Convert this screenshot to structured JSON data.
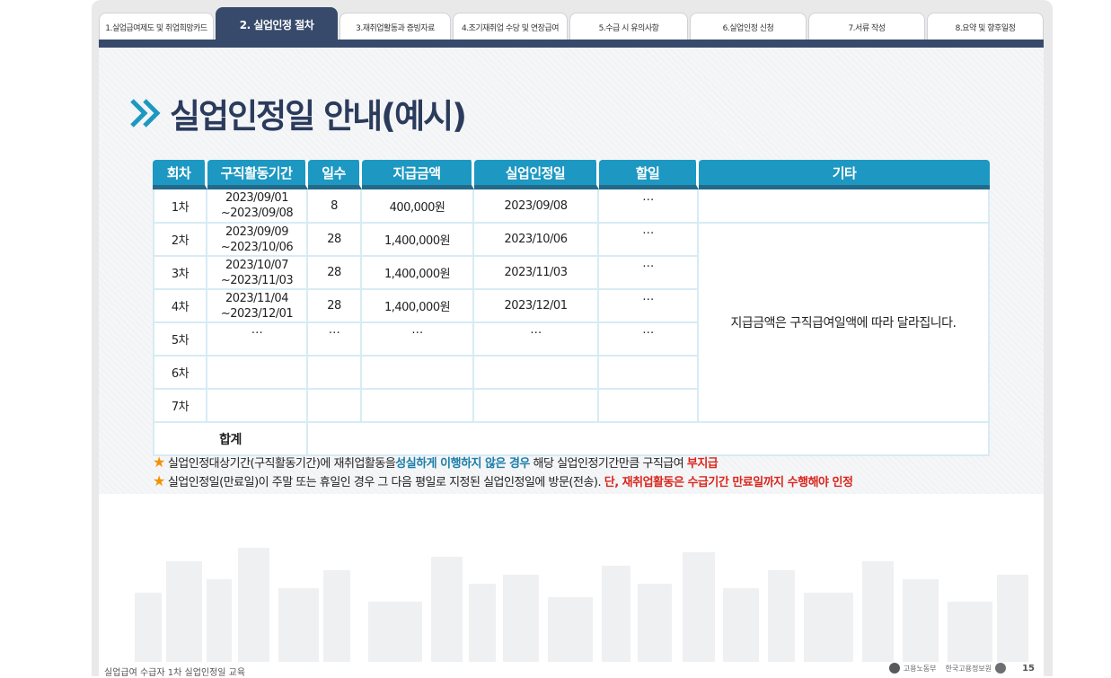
{
  "tabs": [
    {
      "label": "1.실업급여제도 및 취업희망카드",
      "active": false
    },
    {
      "label": "2. 실업인정 절차",
      "active": true
    },
    {
      "label": "3.재취업활동과 증빙자료",
      "active": false
    },
    {
      "label": "4.조기재취업 수당 및 연장급여",
      "active": false
    },
    {
      "label": "5.수급 시 유의사항",
      "active": false
    },
    {
      "label": "6.실업인정 신청",
      "active": false
    },
    {
      "label": "7.서류 작성",
      "active": false
    },
    {
      "label": "8.요약 및 향후일정",
      "active": false
    }
  ],
  "page_title": "실업인정일 안내(예시)",
  "table": {
    "headers": [
      "회차",
      "구직활동기간",
      "일수",
      "지급금액",
      "실업인정일",
      "할일",
      "기타"
    ],
    "rows": [
      {
        "round": "1차",
        "period_start": "2023/09/01",
        "period_end": "~2023/09/08",
        "days": "8",
        "amount": "400,000원",
        "date": "2023/09/08",
        "task": "…"
      },
      {
        "round": "2차",
        "period_start": "2023/09/09",
        "period_end": "~2023/10/06",
        "days": "28",
        "amount": "1,400,000원",
        "date": "2023/10/06",
        "task": "…"
      },
      {
        "round": "3차",
        "period_start": "2023/10/07",
        "period_end": "~2023/11/03",
        "days": "28",
        "amount": "1,400,000원",
        "date": "2023/11/03",
        "task": "…"
      },
      {
        "round": "4차",
        "period_start": "2023/11/04",
        "period_end": "~2023/12/01",
        "days": "28",
        "amount": "1,400,000원",
        "date": "2023/12/01",
        "task": "…"
      },
      {
        "round": "5차",
        "period_start": "…",
        "period_end": "",
        "days": "…",
        "amount": "…",
        "date": "…",
        "task": "…"
      },
      {
        "round": "6차",
        "period_start": "",
        "period_end": "",
        "days": "",
        "amount": "",
        "date": "",
        "task": ""
      },
      {
        "round": "7차",
        "period_start": "",
        "period_end": "",
        "days": "",
        "amount": "",
        "date": "",
        "task": ""
      }
    ],
    "note": "지급금액은 구직급여일액에 따라 달라집니다.",
    "total_label": "합계"
  },
  "notes": [
    {
      "parts": [
        {
          "text": "실업인정대상기간(구직활동기간)에 재취업활동을 ",
          "style": "normal"
        },
        {
          "text": "성실하게 이행하지 않은 경우",
          "style": "blue"
        },
        {
          "text": " 해당 실업인정기간만큼 구직급여 ",
          "style": "normal"
        },
        {
          "text": "부지급",
          "style": "red"
        }
      ]
    },
    {
      "parts": [
        {
          "text": "실업인정일(만료일)이 주말 또는 휴일인 경우 그 다음 평일로 지정된 실업인정일에 방문(전송). ",
          "style": "normal"
        },
        {
          "text": "단, 재취업활동은 수급기간 만료일까지 수행해야 인정",
          "style": "red"
        }
      ]
    }
  ],
  "footer": {
    "text": "실업급여 수급자 1차 실업인정일 교육",
    "org1": "고용노동부",
    "org2": "한국고용정보원",
    "page": "15"
  },
  "colors": {
    "tab_active": "#374a6b",
    "header_bg": "#1d98c2",
    "title": "#2b3b5c",
    "highlight_blue": "#1a7ea8",
    "highlight_red": "#d9261c",
    "star": "#f29200"
  }
}
